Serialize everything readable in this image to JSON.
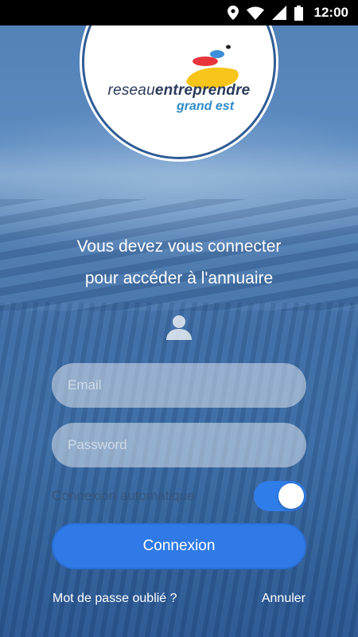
{
  "status_bar": {
    "time": "12:00"
  },
  "logo": {
    "word_light": "reseau",
    "word_bold": "entreprendre",
    "region": "grand est"
  },
  "message": {
    "line1": "Vous devez vous connecter",
    "line2": "pour accéder à l'annuaire"
  },
  "form": {
    "email_placeholder": "Email",
    "password_placeholder": "Password",
    "auto_login_label": "Connexion automatique",
    "auto_login_enabled": true,
    "submit_label": "Connexion",
    "forgot_label": "Mot de passe oublié ?",
    "cancel_label": "Annuler"
  },
  "colors": {
    "accent": "#2f7ae6",
    "logo_text": "#2a3a5a",
    "logo_region": "#2f8bc9"
  }
}
